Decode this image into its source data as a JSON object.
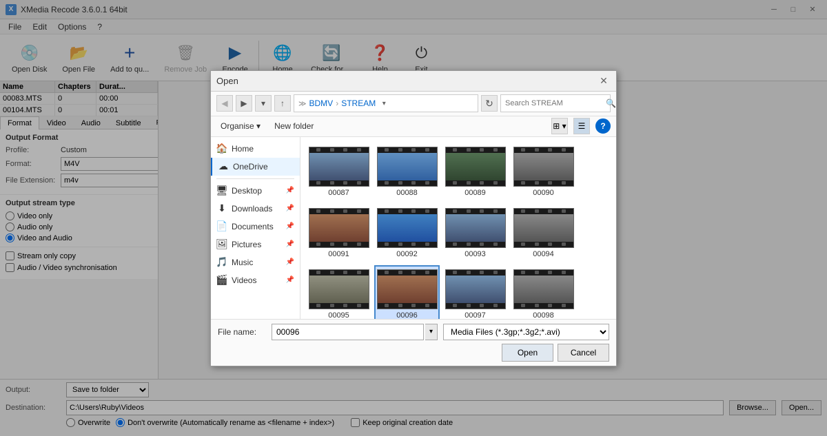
{
  "app": {
    "title": "XMedia Recode 3.6.0.1 64bit",
    "icon": "X"
  },
  "title_controls": {
    "minimize": "─",
    "maximize": "□",
    "close": "✕"
  },
  "menu": {
    "items": [
      "File",
      "Edit",
      "Options",
      "?"
    ]
  },
  "toolbar": {
    "buttons": [
      {
        "id": "open-disk",
        "label": "Open Disk",
        "icon": "💿",
        "disabled": false
      },
      {
        "id": "open-file",
        "label": "Open File",
        "icon": "📂",
        "disabled": false
      },
      {
        "id": "add-to-queue",
        "label": "Add to qu...",
        "icon": "➕",
        "disabled": false
      },
      {
        "id": "remove-job",
        "label": "Remove Job",
        "icon": "🗑",
        "disabled": true
      },
      {
        "id": "encode",
        "label": "Encode",
        "icon": "▶",
        "disabled": false
      },
      {
        "id": "home",
        "label": "Home",
        "icon": "🌐",
        "disabled": false
      },
      {
        "id": "check-for-updates",
        "label": "Check for ...",
        "icon": "🔄",
        "disabled": false
      },
      {
        "id": "help",
        "label": "Help",
        "icon": "❓",
        "disabled": false
      },
      {
        "id": "exit",
        "label": "Exit",
        "icon": "⏻",
        "disabled": false
      }
    ]
  },
  "file_list": {
    "columns": [
      "Name",
      "Chapters",
      "Duration"
    ],
    "rows": [
      {
        "name": "00083.MTS",
        "chapters": "0",
        "duration": "00:00"
      },
      {
        "name": "00104.MTS",
        "chapters": "0",
        "duration": "00:01"
      }
    ]
  },
  "tabs": [
    "Format",
    "Video",
    "Audio",
    "Subtitle",
    "Filters/Preview"
  ],
  "format_section": {
    "title": "Output Format",
    "profile_label": "Profile:",
    "profile_value": "Custom",
    "format_label": "Format:",
    "format_value": "M4V",
    "extension_label": "File Extension:",
    "extension_value": "m4v"
  },
  "stream_section": {
    "title": "Output stream type",
    "options": [
      "Video only",
      "Audio only",
      "Video and Audio"
    ],
    "selected": "Video and Audio"
  },
  "checkboxes": [
    {
      "label": "Stream only copy",
      "checked": false
    },
    {
      "label": "Audio / Video synchronisation",
      "checked": false
    }
  ],
  "bottom": {
    "output_label": "Output:",
    "output_value": "Save to folder",
    "destination_label": "Destination:",
    "destination_value": "C:\\Users\\Ruby\\Videos",
    "browse_label": "Browse...",
    "open_label": "Open...",
    "overwrite_label": "Overwrite",
    "no_overwrite_label": "Don't overwrite (Automatically rename as <filename + index>)",
    "keep_date_label": "Keep original creation date"
  },
  "dialog": {
    "title": "Open",
    "nav": {
      "back_disabled": true,
      "forward_disabled": false,
      "up_disabled": false,
      "breadcrumb": [
        "BDMV",
        "STREAM"
      ],
      "search_placeholder": "Search STREAM"
    },
    "toolbar": {
      "organise": "Organise",
      "new_folder": "New folder"
    },
    "sidebar": {
      "items": [
        {
          "id": "home",
          "label": "Home",
          "icon": "🏠",
          "active": false
        },
        {
          "id": "onedrive",
          "label": "OneDrive",
          "icon": "☁",
          "active": true
        },
        {
          "id": "desktop",
          "label": "Desktop",
          "icon": "🖥",
          "pinned": true
        },
        {
          "id": "downloads",
          "label": "Downloads",
          "icon": "⬇",
          "pinned": true
        },
        {
          "id": "documents",
          "label": "Documents",
          "icon": "📄",
          "pinned": true
        },
        {
          "id": "pictures",
          "label": "Pictures",
          "icon": "🖼",
          "pinned": true
        },
        {
          "id": "music",
          "label": "Music",
          "icon": "🎵",
          "pinned": true
        },
        {
          "id": "videos",
          "label": "Videos",
          "icon": "🎬",
          "pinned": true
        }
      ]
    },
    "files": [
      {
        "id": "00087",
        "label": "00087",
        "scene": "scene-city",
        "selected": false
      },
      {
        "id": "00088",
        "label": "00088",
        "scene": "scene-blue",
        "selected": false
      },
      {
        "id": "00089",
        "label": "00089",
        "scene": "scene-green",
        "selected": false
      },
      {
        "id": "00090",
        "label": "00090",
        "scene": "scene-grey",
        "selected": false
      },
      {
        "id": "00091",
        "label": "00091",
        "scene": "scene-warm",
        "selected": false
      },
      {
        "id": "00092",
        "label": "00092",
        "scene": "scene-water",
        "selected": false
      },
      {
        "id": "00093",
        "label": "00093",
        "scene": "scene-city",
        "selected": false
      },
      {
        "id": "00094",
        "label": "00094",
        "scene": "scene-grey",
        "selected": false
      },
      {
        "id": "00095",
        "label": "00095",
        "scene": "scene-road",
        "selected": false
      },
      {
        "id": "00096",
        "label": "00096",
        "scene": "scene-warm",
        "selected": true
      },
      {
        "id": "00097",
        "label": "00097",
        "scene": "scene-city",
        "selected": false
      },
      {
        "id": "00098",
        "label": "00098",
        "scene": "scene-grey",
        "selected": false
      }
    ],
    "footer": {
      "filename_label": "File name:",
      "filename_value": "00096",
      "filter_label": "",
      "filter_value": "Media Files (*.3gp;*.3g2;*.avi)",
      "open_btn": "Open",
      "cancel_btn": "Cancel"
    }
  }
}
